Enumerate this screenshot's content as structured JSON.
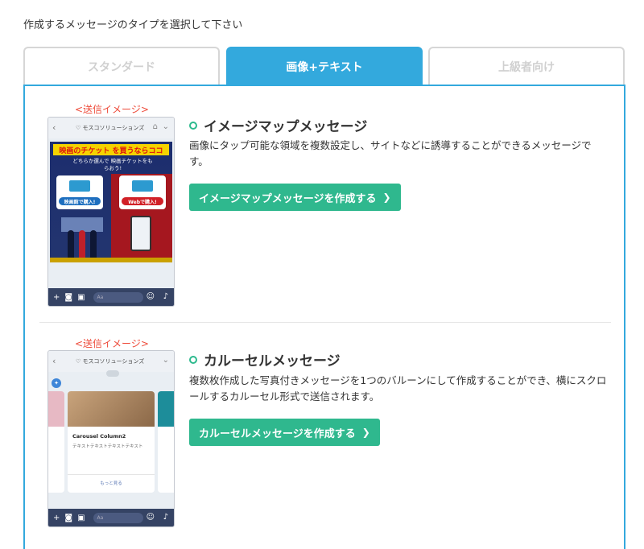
{
  "instruction": "作成するメッセージのタイプを選択して下さい",
  "tabs": [
    {
      "label": "スタンダード",
      "active": false
    },
    {
      "label": "画像+テキスト",
      "active": true
    },
    {
      "label": "上級者向け",
      "active": false
    }
  ],
  "colors": {
    "accent": "#33a9dd",
    "button": "#2fb88e",
    "send_label": "#ee4b3a"
  },
  "sections": [
    {
      "send_label": "<送信イメージ>",
      "title": "イメージマップメッセージ",
      "description": "画像にタップ可能な領域を複数設定し、サイトなどに誘導することができるメッセージです。",
      "button": "イメージマップメッセージを作成する",
      "preview": {
        "account": "モスコソリューションズ",
        "promo_title": "映画のチケット を買うならココ",
        "promo_sub": "どちらか選んで 映画チケットをもらおう!",
        "card1": "映画館で購入!",
        "card2": "Webで購入!",
        "input_placeholder": "Aa"
      }
    },
    {
      "send_label": "<送信イメージ>",
      "title": "カルーセルメッセージ",
      "description": "複数枚作成した写真付きメッセージを1つのバルーンにして作成することができ、横にスクロールするカルーセル形式で送信されます。",
      "button": "カルーセルメッセージを作成する",
      "preview": {
        "account": "モスコソリューションズ",
        "card_title": "Carousel Column2",
        "card_desc": "テキストテキストテキストテキスト",
        "card_more": "もっと見る",
        "input_placeholder": "Aa"
      }
    }
  ]
}
